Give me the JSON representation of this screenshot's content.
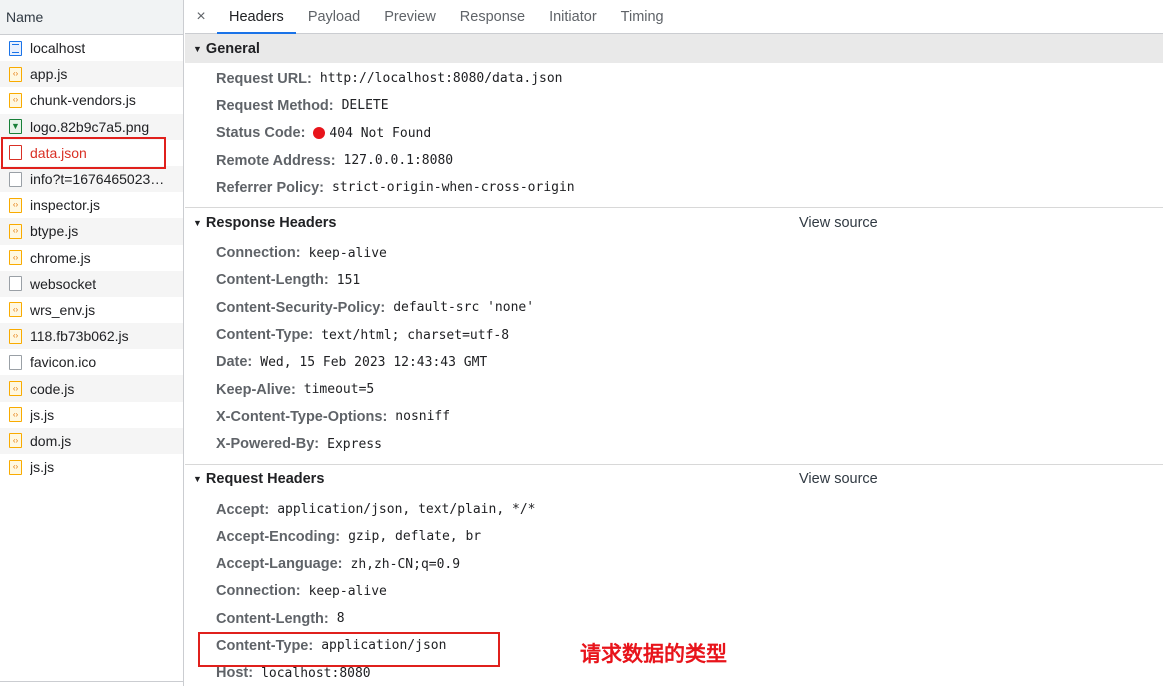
{
  "sidebar": {
    "header": "Name",
    "items": [
      {
        "label": "localhost",
        "icon": "document-icon",
        "type": "doc"
      },
      {
        "label": "app.js",
        "icon": "script-icon",
        "type": "script"
      },
      {
        "label": "chunk-vendors.js",
        "icon": "script-icon",
        "type": "script"
      },
      {
        "label": "logo.82b9c7a5.png",
        "icon": "image-icon",
        "type": "img"
      },
      {
        "label": "data.json",
        "icon": "file-error-icon",
        "type": "red"
      },
      {
        "label": "info?t=1676465023…",
        "icon": "file-icon",
        "type": "plain"
      },
      {
        "label": "inspector.js",
        "icon": "script-icon",
        "type": "script"
      },
      {
        "label": "btype.js",
        "icon": "script-icon",
        "type": "script"
      },
      {
        "label": "chrome.js",
        "icon": "script-icon",
        "type": "script"
      },
      {
        "label": "websocket",
        "icon": "file-icon",
        "type": "plain"
      },
      {
        "label": "wrs_env.js",
        "icon": "script-icon",
        "type": "script"
      },
      {
        "label": "118.fb73b062.js",
        "icon": "script-icon",
        "type": "script"
      },
      {
        "label": "favicon.ico",
        "icon": "file-icon",
        "type": "plain"
      },
      {
        "label": "code.js",
        "icon": "script-icon",
        "type": "script"
      },
      {
        "label": "js.js",
        "icon": "script-icon",
        "type": "script"
      },
      {
        "label": "dom.js",
        "icon": "script-icon",
        "type": "script"
      },
      {
        "label": "js.js",
        "icon": "script-icon",
        "type": "script"
      }
    ]
  },
  "tabs": {
    "close": "×",
    "items": [
      "Headers",
      "Payload",
      "Preview",
      "Response",
      "Initiator",
      "Timing"
    ]
  },
  "general": {
    "title": "General",
    "rows": [
      {
        "key": "Request URL:",
        "value": "http://localhost:8080/data.json"
      },
      {
        "key": "Request Method:",
        "value": "DELETE"
      },
      {
        "key": "Status Code:",
        "value": "404 Not Found"
      },
      {
        "key": "Remote Address:",
        "value": "127.0.0.1:8080"
      },
      {
        "key": "Referrer Policy:",
        "value": "strict-origin-when-cross-origin"
      }
    ]
  },
  "response_headers": {
    "title": "Response Headers",
    "view_source": "View source",
    "rows": [
      {
        "key": "Connection:",
        "value": "keep-alive"
      },
      {
        "key": "Content-Length:",
        "value": "151"
      },
      {
        "key": "Content-Security-Policy:",
        "value": "default-src 'none'"
      },
      {
        "key": "Content-Type:",
        "value": "text/html; charset=utf-8"
      },
      {
        "key": "Date:",
        "value": "Wed, 15 Feb 2023 12:43:43 GMT"
      },
      {
        "key": "Keep-Alive:",
        "value": "timeout=5"
      },
      {
        "key": "X-Content-Type-Options:",
        "value": "nosniff"
      },
      {
        "key": "X-Powered-By:",
        "value": "Express"
      }
    ]
  },
  "request_headers": {
    "title": "Request Headers",
    "view_source": "View source",
    "rows": [
      {
        "key": "Accept:",
        "value": "application/json, text/plain, */*"
      },
      {
        "key": "Accept-Encoding:",
        "value": "gzip, deflate, br"
      },
      {
        "key": "Accept-Language:",
        "value": "zh,zh-CN;q=0.9"
      },
      {
        "key": "Connection:",
        "value": "keep-alive"
      },
      {
        "key": "Content-Length:",
        "value": "8"
      },
      {
        "key": "Content-Type:",
        "value": "application/json"
      },
      {
        "key": "Host:",
        "value": "localhost:8080"
      }
    ]
  },
  "annotation": "请求数据的类型",
  "colors": {
    "accent": "#1a73e8",
    "error": "#d93025",
    "highlight": "#e0201c"
  }
}
